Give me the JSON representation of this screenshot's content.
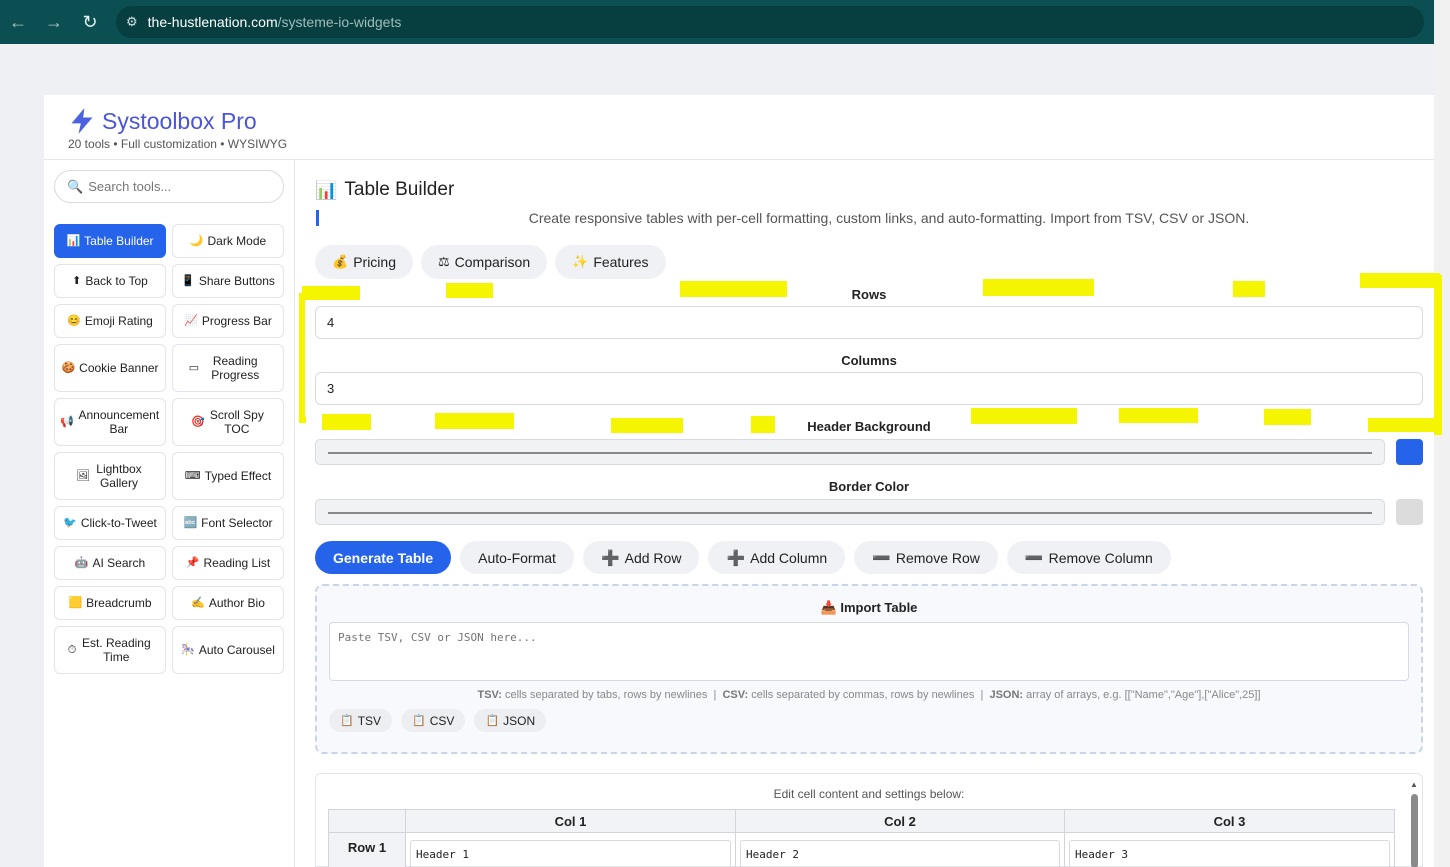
{
  "browser": {
    "url_domain": "the-hustlenation.com",
    "url_path": "/systeme-io-widgets"
  },
  "brand": {
    "title": "Systoolbox Pro",
    "subtitle": "20 tools • Full customization • WYSIWYG",
    "accent_color": "#4b55d8"
  },
  "sidebar": {
    "search_placeholder": "Search tools...",
    "tools": [
      {
        "icon": "📊",
        "label": "Table Builder",
        "active": true
      },
      {
        "icon": "🌙",
        "label": "Dark Mode"
      },
      {
        "icon": "⬆",
        "label": "Back to Top"
      },
      {
        "icon": "📱",
        "label": "Share Buttons"
      },
      {
        "icon": "😊",
        "label": "Emoji Rating"
      },
      {
        "icon": "📈",
        "label": "Progress Bar"
      },
      {
        "icon": "🍪",
        "label": "Cookie Banner"
      },
      {
        "icon": "▭",
        "label": "Reading Progress"
      },
      {
        "icon": "📢",
        "label": "Announcement Bar"
      },
      {
        "icon": "🎯",
        "label": "Scroll Spy TOC"
      },
      {
        "icon": "🖼",
        "label": "Lightbox Gallery"
      },
      {
        "icon": "⌨",
        "label": "Typed Effect"
      },
      {
        "icon": "🐦",
        "label": "Click-to-Tweet"
      },
      {
        "icon": "🔤",
        "label": "Font Selector"
      },
      {
        "icon": "🤖",
        "label": "AI Search"
      },
      {
        "icon": "📌",
        "label": "Reading List"
      },
      {
        "icon": "🟨",
        "label": "Breadcrumb"
      },
      {
        "icon": "✍",
        "label": "Author Bio"
      },
      {
        "icon": "⏱",
        "label": "Est. Reading Time"
      },
      {
        "icon": "🎠",
        "label": "Auto Carousel"
      }
    ]
  },
  "main": {
    "title_icon": "📊",
    "title": "Table Builder",
    "subtitle": "Create responsive tables with per-cell formatting, custom links, and auto-formatting. Import from TSV, CSV or JSON.",
    "presets": [
      {
        "icon": "💰",
        "label": "Pricing"
      },
      {
        "icon": "⚖",
        "label": "Comparison"
      },
      {
        "icon": "✨",
        "label": "Features"
      }
    ],
    "rows_label": "Rows",
    "rows_value": "4",
    "columns_label": "Columns",
    "columns_value": "3",
    "header_bg_label": "Header Background",
    "header_bg_color": "#2563eb",
    "border_color_label": "Border Color",
    "border_color": "#dcdcdc",
    "actions": {
      "generate": "Generate Table",
      "auto_format": "Auto-Format",
      "add_row": "Add Row",
      "add_column": "Add Column",
      "remove_row": "Remove Row",
      "remove_column": "Remove Column"
    },
    "import": {
      "title": "Import Table",
      "placeholder": "Paste TSV, CSV or JSON here...",
      "hint_tsv_key": "TSV:",
      "hint_tsv": "cells separated by tabs, rows by newlines",
      "hint_csv_key": "CSV:",
      "hint_csv": "cells separated by commas, rows by newlines",
      "hint_json_key": "JSON:",
      "hint_json": "array of arrays, e.g. [[\"Name\",\"Age\"],[\"Alice\",25]]",
      "buttons": [
        "TSV",
        "CSV",
        "JSON"
      ]
    },
    "editor": {
      "note": "Edit cell content and settings below:",
      "columns": [
        "Col 1",
        "Col 2",
        "Col 3"
      ],
      "rows": [
        {
          "label": "Row 1",
          "cells": [
            "Header 1",
            "Header 2",
            "Header 3"
          ]
        }
      ]
    }
  }
}
